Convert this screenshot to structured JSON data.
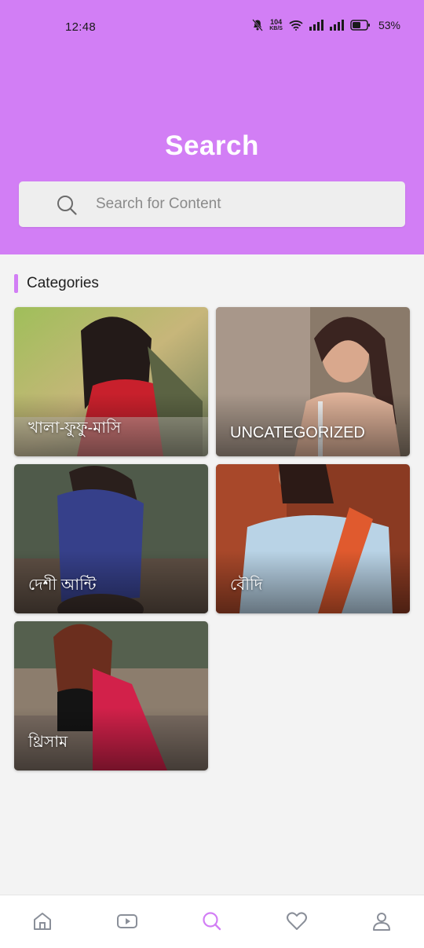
{
  "status_bar": {
    "time": "12:48",
    "net_speed_value": "104",
    "net_speed_unit": "KB/S",
    "battery": "53%"
  },
  "page": {
    "title": "Search"
  },
  "search": {
    "placeholder": "Search for Content",
    "value": ""
  },
  "categories": {
    "title": "Categories",
    "items": [
      {
        "label": "খালা-ফুফু-মাসি"
      },
      {
        "label": "UNCATEGORIZED"
      },
      {
        "label": "দেশী আন্টি"
      },
      {
        "label": "বৌদি"
      },
      {
        "label": "থ্রিসাম"
      }
    ]
  },
  "nav": {
    "items": [
      "home-icon",
      "video-icon",
      "search-icon",
      "heart-icon",
      "profile-icon"
    ],
    "active": "search-icon"
  },
  "colors": {
    "accent": "#d27ef5",
    "background": "#f3f3f3",
    "icon_inactive": "#8a8f99"
  }
}
